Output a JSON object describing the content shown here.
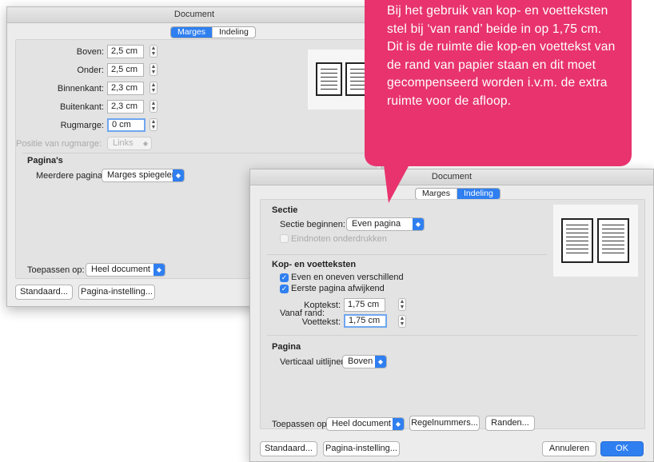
{
  "dialog1": {
    "title": "Document",
    "tabs": [
      "Marges",
      "Indeling"
    ],
    "margins": [
      {
        "label": "Boven:",
        "value": "2,5 cm"
      },
      {
        "label": "Onder:",
        "value": "2,5 cm"
      },
      {
        "label": "Binnenkant:",
        "value": "2,3 cm"
      },
      {
        "label": "Buitenkant:",
        "value": "2,3 cm"
      },
      {
        "label": "Rugmarge:",
        "value": "0 cm"
      }
    ],
    "gutter_position_label": "Positie van rugmarge:",
    "gutter_position_value": "Links",
    "pages_heading": "Pagina's",
    "multiple_pages_label": "Meerdere pagina's:",
    "multiple_pages_value": "Marges spiegelen",
    "apply_label": "Toepassen op:",
    "apply_value": "Heel document",
    "default_button": "Standaard...",
    "page_setup_button": "Pagina-instelling..."
  },
  "callout": {
    "text": "Bij het gebruik van kop- en voetteksten stel bij ‘van rand’ beide in op 1,75 cm. Dit is de ruimte die kop-en voettekst van de rand van papier staan en dit moet gecompenseerd worden i.v.m. de extra ruimte voor de afloop."
  },
  "dialog2": {
    "title": "Document",
    "tabs": [
      "Marges",
      "Indeling"
    ],
    "section_heading": "Sectie",
    "section_start_label": "Sectie beginnen:",
    "section_start_value": "Even pagina",
    "suppress_endnotes_label": "Eindnoten onderdrukken",
    "header_footer_heading": "Kop- en voetteksten",
    "odd_even_label": "Even en oneven verschillend",
    "first_page_label": "Eerste pagina afwijkend",
    "from_edge_label": "Vanaf rand:",
    "header_label": "Koptekst:",
    "header_value": "1,75 cm",
    "footer_label": "Voettekst:",
    "footer_value": "1,75 cm",
    "page_heading": "Pagina",
    "vertical_align_label": "Verticaal uitlijnen:",
    "vertical_align_value": "Boven",
    "apply_label": "Toepassen op:",
    "apply_value": "Heel document",
    "line_numbers_button": "Regelnummers...",
    "borders_button": "Randen...",
    "default_button": "Standaard...",
    "page_setup_button": "Pagina-instelling...",
    "cancel_button": "Annuleren",
    "ok_button": "OK"
  },
  "colors": {
    "accent": "#2f7ff0",
    "callout": "#e8336f",
    "dialog_bg": "#ececec"
  }
}
